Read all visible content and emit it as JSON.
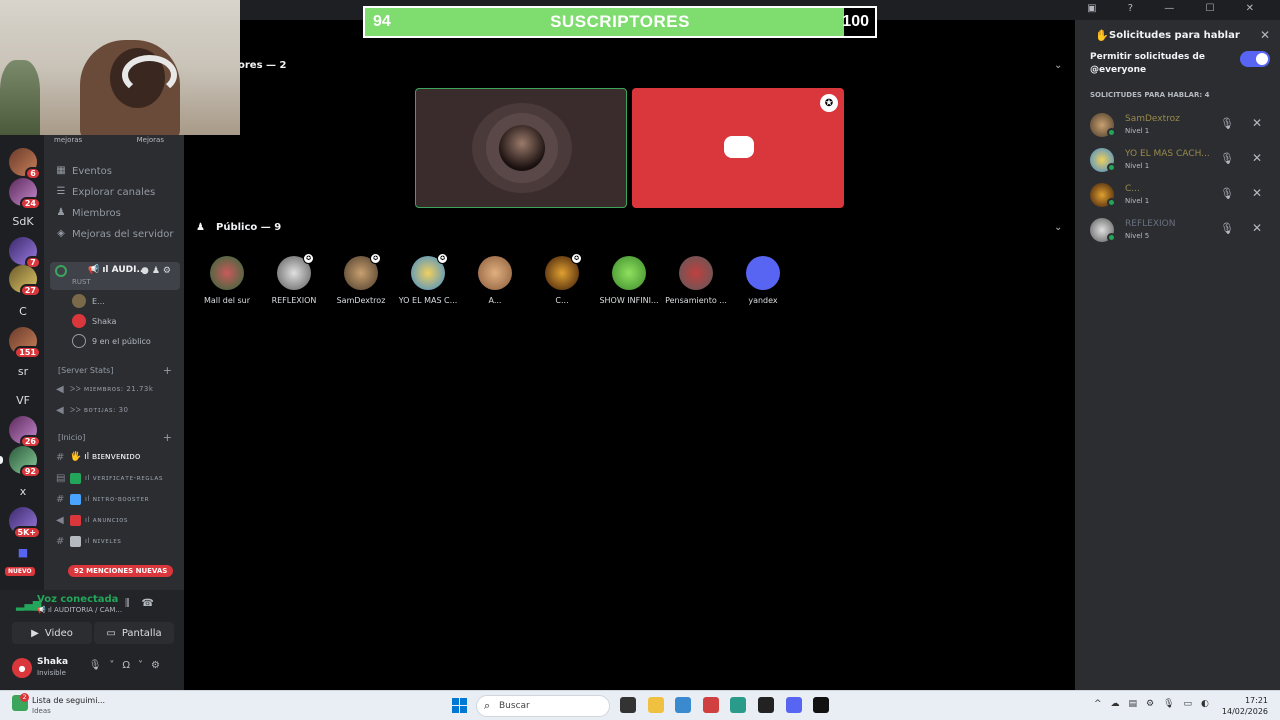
{
  "overlay": {
    "progress_title": "SUSCRIPTORES",
    "progress_current": "94",
    "progress_goal": "100",
    "progress_fraction": 0.94
  },
  "rail": {
    "servers": [
      {
        "label": "",
        "badge": "6"
      },
      {
        "label": "",
        "badge": "24"
      },
      {
        "label": "SdK",
        "badge": ""
      },
      {
        "label": "",
        "badge": "7"
      },
      {
        "label": "",
        "badge": "27"
      },
      {
        "label": "C",
        "badge": ""
      },
      {
        "label": "",
        "badge": "151"
      },
      {
        "label": "sr",
        "badge": ""
      },
      {
        "label": "VF",
        "badge": ""
      },
      {
        "label": "",
        "badge": "26"
      },
      {
        "label": "",
        "badge": "92"
      },
      {
        "label": "x",
        "badge": ""
      },
      {
        "label": "",
        "badge": "5K+"
      }
    ],
    "nuevo": "NUEVO"
  },
  "sidebar": {
    "boosts": [
      "mejoras",
      "Mejoras"
    ],
    "nav": [
      {
        "label": "Eventos",
        "icon": "calendar-icon"
      },
      {
        "label": "Explorar canales",
        "icon": "channels-icon"
      },
      {
        "label": "Miembros",
        "icon": "members-icon"
      },
      {
        "label": "Mejoras del servidor",
        "icon": "boost-icon"
      }
    ],
    "voice_channel": {
      "name": "📢 ıl AUDI...",
      "sub": "RUST"
    },
    "stage_members": [
      {
        "name": "E..."
      },
      {
        "name": "Shaka"
      }
    ],
    "audience_count": "9 en el público",
    "categories": [
      {
        "label": "[Server Stats]"
      },
      {
        "label": "[Inicio]"
      }
    ],
    "stats": [
      {
        "label": "ᐳᐳ ᴍɪᴇᴍʙʀᴏꜱ: 21.73k"
      },
      {
        "label": "ᐳᐳ ʙᴏᴛɪᴊᴀꜱ: 30"
      }
    ],
    "channels": [
      {
        "label": "🖐 ıl ʙɪᴇɴᴠᴇɴɪᴅᴏ",
        "active": true
      },
      {
        "label": "ıl ᴠᴇʀɪꜰɪᴄᴀᴛᴇ-ʀᴇɢʟᴀꜱ"
      },
      {
        "label": "ıl ɴɪᴛʀᴏ-ʙᴏᴏꜱᴛᴇʀ"
      },
      {
        "label": "ıl ᴀɴᴜɴᴄɪᴏꜱ"
      },
      {
        "label": "ıl ɴɪᴠᴇʟᴇꜱ"
      }
    ],
    "mentions": "92 MENCIONES NUEVAS"
  },
  "voice_panel": {
    "status": "Voz conectada",
    "channel": "📢 ıl AUDITORIA / CAM...",
    "video": "Video",
    "screen": "Pantalla",
    "user_name": "Shaka",
    "user_status": "Invisible"
  },
  "stage": {
    "speakers_title": "ores — 2",
    "audience_title": "Público — 9",
    "audience": [
      {
        "name": "Mall del sur",
        "mod": false
      },
      {
        "name": "REFLEXION",
        "mod": true
      },
      {
        "name": "SamDextroz",
        "mod": true
      },
      {
        "name": "YO EL MAS C...",
        "mod": true
      },
      {
        "name": "A...",
        "mod": false
      },
      {
        "name": "C...",
        "mod": true
      },
      {
        "name": "SHOW INFINI...",
        "mod": false
      },
      {
        "name": "Pensamiento ...",
        "mod": false
      },
      {
        "name": "yandex",
        "mod": false
      }
    ]
  },
  "right_panel": {
    "title": "Solicitudes para hablar",
    "permission": "Permitir solicitudes de @everyone",
    "count_label": "SOLICITUDES PARA HABLAR: 4",
    "requests": [
      {
        "name": "SamDextroz",
        "level": "Nivel 1",
        "color": "#9a8a4a"
      },
      {
        "name": "YO EL MAS CACH...",
        "level": "Nivel 1",
        "color": "#9a8a4a"
      },
      {
        "name": "C...",
        "level": "Nivel 1",
        "color": "#9a8a4a"
      },
      {
        "name": "REFLEXION",
        "level": "Nivel 5",
        "color": "#6a7080"
      }
    ]
  },
  "taskbar": {
    "weather_title": "Lista de seguimi...",
    "weather_sub": "Ideas",
    "weather_badge": "2",
    "search": "Buscar",
    "time": "17:21",
    "date": "14/02/2026"
  }
}
